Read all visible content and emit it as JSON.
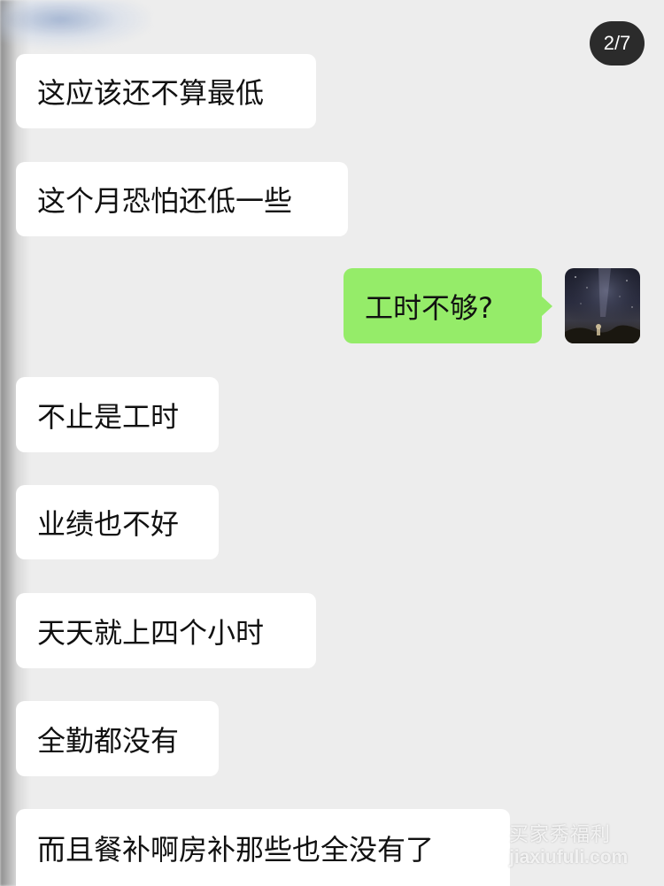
{
  "counter": "2/7",
  "messages": [
    {
      "side": "left",
      "text": "这应该还不算最低"
    },
    {
      "side": "left",
      "text": "这个月恐怕还低一些"
    },
    {
      "side": "right",
      "text": "工时不够?"
    },
    {
      "side": "left",
      "text": "不止是工时"
    },
    {
      "side": "left",
      "text": "业绩也不好"
    },
    {
      "side": "left",
      "text": "天天就上四个小时"
    },
    {
      "side": "left",
      "text": "全勤都没有"
    },
    {
      "side": "left",
      "text": "而且餐补啊房补那些也全没有了"
    }
  ],
  "watermark": {
    "cn": "买家秀福利",
    "en": "jiaxiufuli.com"
  },
  "colors": {
    "background": "#ededed",
    "bubble_left": "#ffffff",
    "bubble_right": "#95ec69",
    "counter_bg": "#2b2b2b"
  },
  "icons": {
    "avatar": "night-sky-avatar"
  }
}
